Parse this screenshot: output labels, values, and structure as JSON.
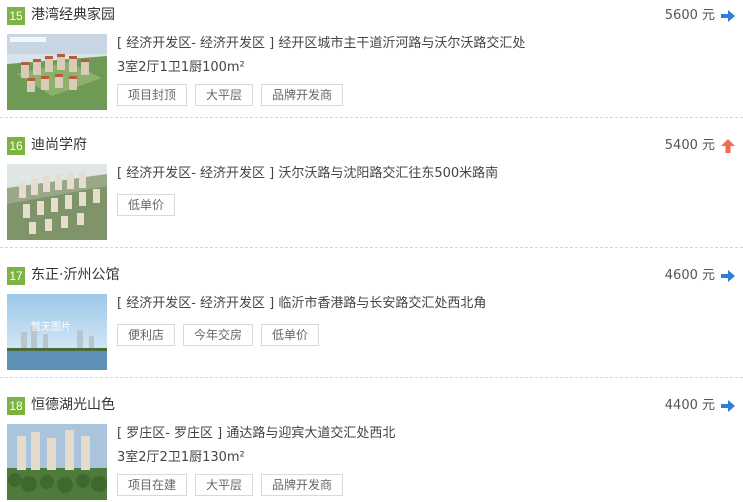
{
  "listings": [
    {
      "rank": "15",
      "name": "港湾经典家园",
      "price": "5600 元",
      "trend_icon": "arrow-right-icon",
      "address": "[ 经济开发区- 经济开发区 ] 经开区城市主干道沂河路与沃尔沃路交汇处",
      "layout": "3室2厅1卫1厨100m²",
      "tags": [
        "项目封顶",
        "大平层",
        "品牌开发商"
      ]
    },
    {
      "rank": "16",
      "name": "迪尚学府",
      "price": "5400 元",
      "trend_icon": "arrow-up-icon",
      "address": "[ 经济开发区- 经济开发区 ] 沃尔沃路与沈阳路交汇往东500米路南",
      "layout": "",
      "tags": [
        "低单价"
      ]
    },
    {
      "rank": "17",
      "name": "东正·沂州公馆",
      "price": "4600 元",
      "trend_icon": "arrow-right-icon",
      "address": "[ 经济开发区- 经济开发区 ] 临沂市香港路与长安路交汇处西北角",
      "layout": "",
      "tags": [
        "便利店",
        "今年交房",
        "低单价"
      ],
      "thumb_text": "暂无图片"
    },
    {
      "rank": "18",
      "name": "恒德湖光山色",
      "price": "4400 元",
      "trend_icon": "arrow-right-icon",
      "address": "[ 罗庄区- 罗庄区 ] 通达路与迎宾大道交汇处西北",
      "layout": "3室2厅2卫1厨130m²",
      "tags": [
        "项目在建",
        "大平层",
        "品牌开发商"
      ]
    }
  ],
  "colors": {
    "rank_bg": "#7cb342",
    "arrow_right": "#2f7fd8",
    "arrow_up": "#f26b4f"
  }
}
